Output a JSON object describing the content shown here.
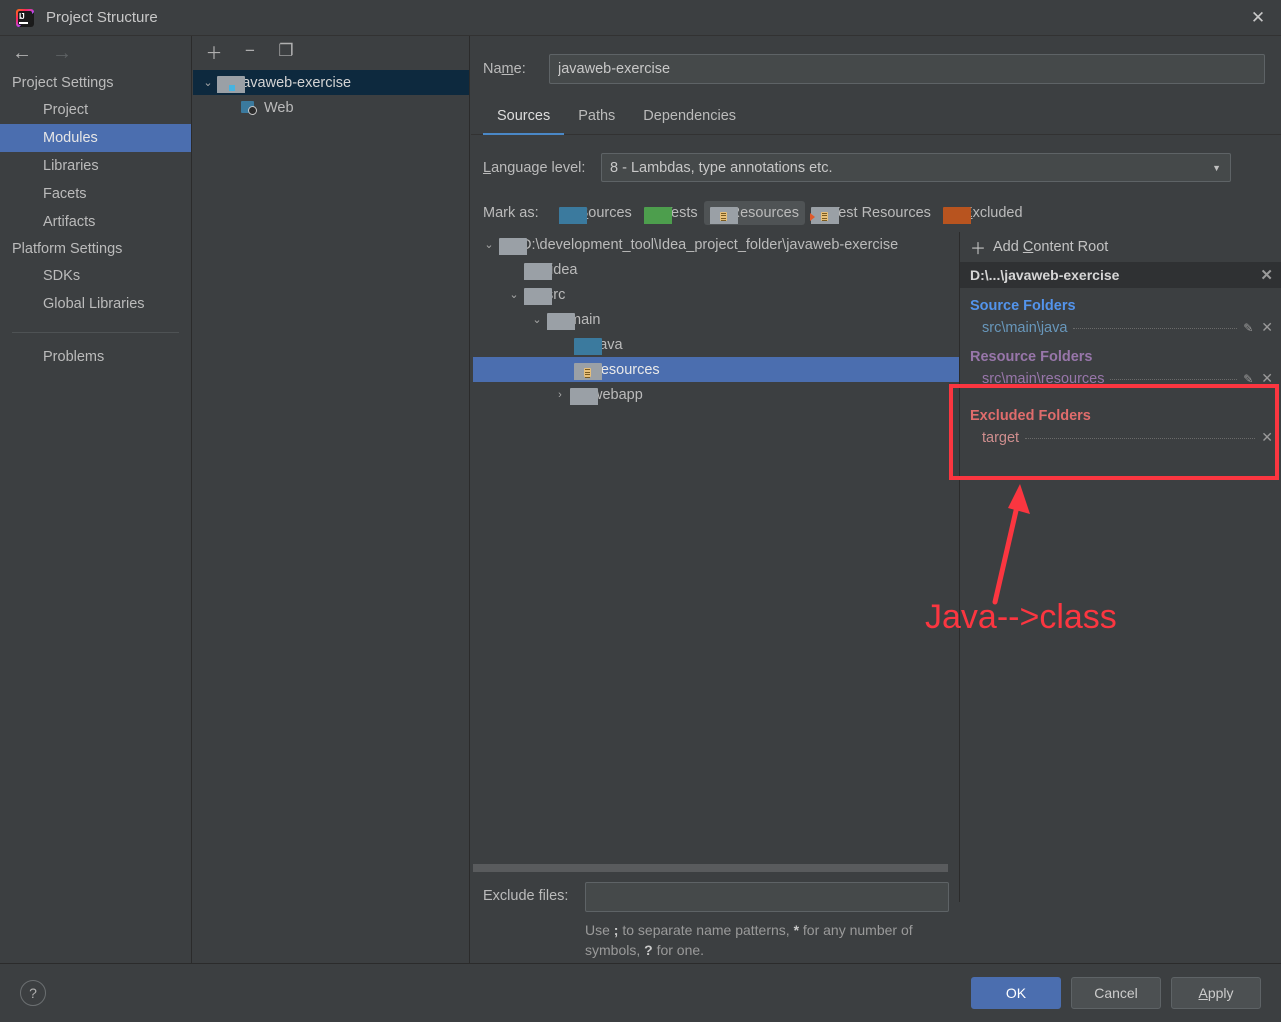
{
  "window": {
    "title": "Project Structure",
    "app_icon": "intellij-idea-icon",
    "close_label": "✕"
  },
  "sidebar": {
    "nav": {
      "back": "←",
      "forward": "→"
    },
    "groups": [
      {
        "label": "Project Settings",
        "items": [
          {
            "label": "Project",
            "selected": false
          },
          {
            "label": "Modules",
            "selected": true
          },
          {
            "label": "Libraries",
            "selected": false
          },
          {
            "label": "Facets",
            "selected": false
          },
          {
            "label": "Artifacts",
            "selected": false
          }
        ]
      },
      {
        "label": "Platform Settings",
        "items": [
          {
            "label": "SDKs",
            "selected": false
          },
          {
            "label": "Global Libraries",
            "selected": false
          }
        ]
      }
    ],
    "problems": {
      "label": "Problems"
    }
  },
  "module_tree": {
    "toolbar": [
      {
        "name": "add-module-button",
        "glyph": "＋"
      },
      {
        "name": "remove-module-button",
        "glyph": "−"
      },
      {
        "name": "copy-module-button",
        "glyph": "❐"
      }
    ],
    "rows": [
      {
        "label": "javaweb-exercise",
        "indent": 0,
        "chevron": "⌄",
        "icon": "module-folder-icon",
        "selected": true
      },
      {
        "label": "Web",
        "indent": 1,
        "chevron": "",
        "icon": "web-facet-icon",
        "selected": false
      }
    ]
  },
  "main": {
    "name_label": "Na",
    "name_label_underlined": "m",
    "name_label_rest": "e:",
    "name_value": "javaweb-exercise",
    "tabs": [
      {
        "label": "Sources",
        "active": true
      },
      {
        "label": "Paths",
        "active": false
      },
      {
        "label": "Dependencies",
        "active": false
      }
    ],
    "language_level": {
      "label_u": "L",
      "label_rest": "anguage level:",
      "value": "8 - Lambdas, type annotations etc.",
      "arrow": "▼"
    },
    "mark_as": {
      "label": "Mark as:",
      "options": [
        {
          "u": "S",
          "rest": "ources",
          "color": "blue",
          "active": false
        },
        {
          "u": "T",
          "rest": "ests",
          "color": "green",
          "active": false
        },
        {
          "u": "",
          "rest": "Resources",
          "color": "gray-lines",
          "active": true
        },
        {
          "u": "",
          "rest": "Test Resources",
          "color": "gray-lines-tri",
          "active": false
        },
        {
          "u": "E",
          "rest": "xcluded",
          "color": "orange",
          "active": false
        }
      ]
    },
    "source_tree": [
      {
        "label": "D:\\development_tool\\Idea_project_folder\\javaweb-exercise",
        "indent": 0,
        "chevron": "⌄",
        "icon": "gray",
        "selected": false
      },
      {
        "label": ".idea",
        "indent": 1,
        "chevron": "",
        "icon": "gray",
        "selected": false
      },
      {
        "label": "src",
        "indent": 1,
        "chevron": "⌄",
        "icon": "gray",
        "selected": false
      },
      {
        "label": "main",
        "indent": 2,
        "chevron": "⌄",
        "icon": "gray",
        "selected": false
      },
      {
        "label": "java",
        "indent": 3,
        "chevron": "",
        "icon": "blue",
        "selected": false
      },
      {
        "label": "resources",
        "indent": 3,
        "chevron": "",
        "icon": "resources",
        "selected": true
      },
      {
        "label": "webapp",
        "indent": 2,
        "chevron": "›",
        "icon": "gray",
        "selected": false
      }
    ],
    "exclude_files": {
      "label": "Exclude files:",
      "value": "",
      "placeholder": "",
      "hint_a": "Use ",
      "hint_semi": ";",
      "hint_b": " to separate name patterns, ",
      "hint_star": "*",
      "hint_c": " for any number of symbols, ",
      "hint_q": "?",
      "hint_d": " for one."
    }
  },
  "roots_panel": {
    "add_content_root": {
      "pre": "Add ",
      "u": "C",
      "rest": "ontent Root",
      "plus": "＋"
    },
    "root_header": {
      "label": "D:\\...\\javaweb-exercise",
      "close": "✕"
    },
    "sections": [
      {
        "kind": "source",
        "title": "Source Folders",
        "entries": [
          {
            "path": "src\\main\\java",
            "has_pencil": true,
            "close": "✕"
          }
        ]
      },
      {
        "kind": "resource",
        "title": "Resource Folders",
        "entries": [
          {
            "path": "src\\main\\resources",
            "has_pencil": true,
            "close": "✕"
          }
        ]
      },
      {
        "kind": "excluded",
        "title": "Excluded Folders",
        "entries": [
          {
            "path": "target",
            "has_pencil": false,
            "close": "✕"
          }
        ]
      }
    ]
  },
  "annotation": {
    "box_color": "#fb3640",
    "arrow_color": "#fb3640",
    "text": "Java-->class"
  },
  "footer": {
    "help": "?",
    "ok": "OK",
    "cancel": "Cancel",
    "apply_u": "A",
    "apply_rest": "pply"
  }
}
